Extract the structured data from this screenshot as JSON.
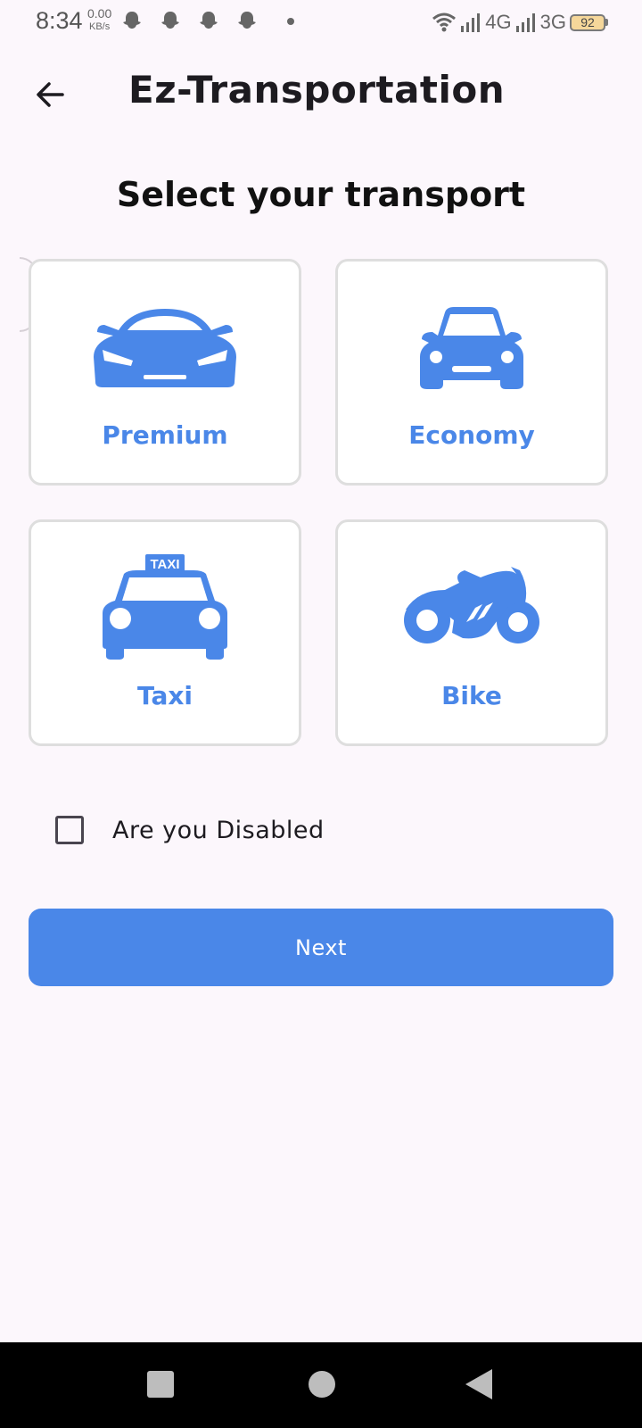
{
  "status_bar": {
    "time": "8:34",
    "net_speed_value": "0.00",
    "net_speed_unit": "KB/s",
    "network_1": "4G",
    "network_2": "3G",
    "battery": "92"
  },
  "app_bar": {
    "title": "Ez-Transportation",
    "back_icon": "arrow-back-icon"
  },
  "main": {
    "heading": "Select your transport",
    "options": [
      {
        "label": "Premium",
        "icon": "sports-car-icon"
      },
      {
        "label": "Economy",
        "icon": "car-front-icon"
      },
      {
        "label": "Taxi",
        "icon": "taxi-icon"
      },
      {
        "label": "Bike",
        "icon": "motorbike-icon"
      }
    ],
    "disabled_checkbox": {
      "label": "Are you Disabled",
      "checked": false
    },
    "next_label": "Next"
  },
  "colors": {
    "accent": "#4a87e8",
    "background": "#fcf7fc"
  }
}
